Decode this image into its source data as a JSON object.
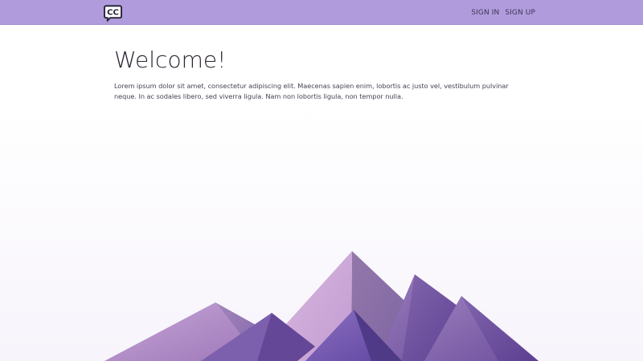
{
  "header": {
    "logo_name": "cc-chat-logo",
    "logo_text": "CC",
    "nav_links": [
      {
        "label": "SIGN IN"
      },
      {
        "label": "SIGN UP"
      }
    ]
  },
  "main": {
    "title": "Welcome!",
    "body": "Lorem ipsum dolor sit amet, consectetur adipiscing elit. Maecenas sapien enim, lobortis ac justo vel, vestibulum pulvinar neque. In ac sodales libero, sed viverra ligula. Nam non lobortis ligula, non tempor nulla."
  },
  "colors": {
    "navbar": "#b09cdc",
    "mountain_light": "#c9a8d8",
    "mountain_mid": "#9a79b9",
    "mountain_dark": "#5e3f95"
  }
}
